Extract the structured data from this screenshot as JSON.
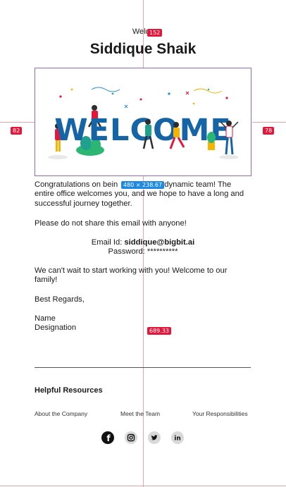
{
  "overlay": {
    "top_badge": "152",
    "left_badge": "82",
    "right_badge": "78",
    "size_badge": "480 × 238.67",
    "height_badge": "689.33"
  },
  "header": {
    "welcome_pre": "Welco",
    "name": "Siddique Shaik"
  },
  "banner": {
    "text": "WELCOME"
  },
  "body": {
    "p1_start": "Congratulations on bein",
    "p1_end": " dynamic team! The entire office welcomes you, and we hope to have a long and successful journey together.",
    "p2": "Please do not share this email with anyone!",
    "email_label": "Email Id: ",
    "email_value": "siddique@bigbit.ai",
    "password_label": "Password: ",
    "password_value": "**********",
    "p3": "We can't wait to start working with you! Welcome to our family!",
    "regards": "Best Regards,",
    "sig_name": "Name",
    "sig_designation": "Designation"
  },
  "resources": {
    "title": "Helpful Resources",
    "links": [
      "About the Company",
      "Meet the Team",
      "Your Responsibilities"
    ]
  },
  "social": {
    "facebook": "f",
    "linkedin": "in"
  },
  "colors": {
    "accent_red": "#e5163a",
    "accent_blue": "#1e88e5",
    "welcome_text": "#1565a6",
    "banner_border": "#8e6bc7"
  }
}
